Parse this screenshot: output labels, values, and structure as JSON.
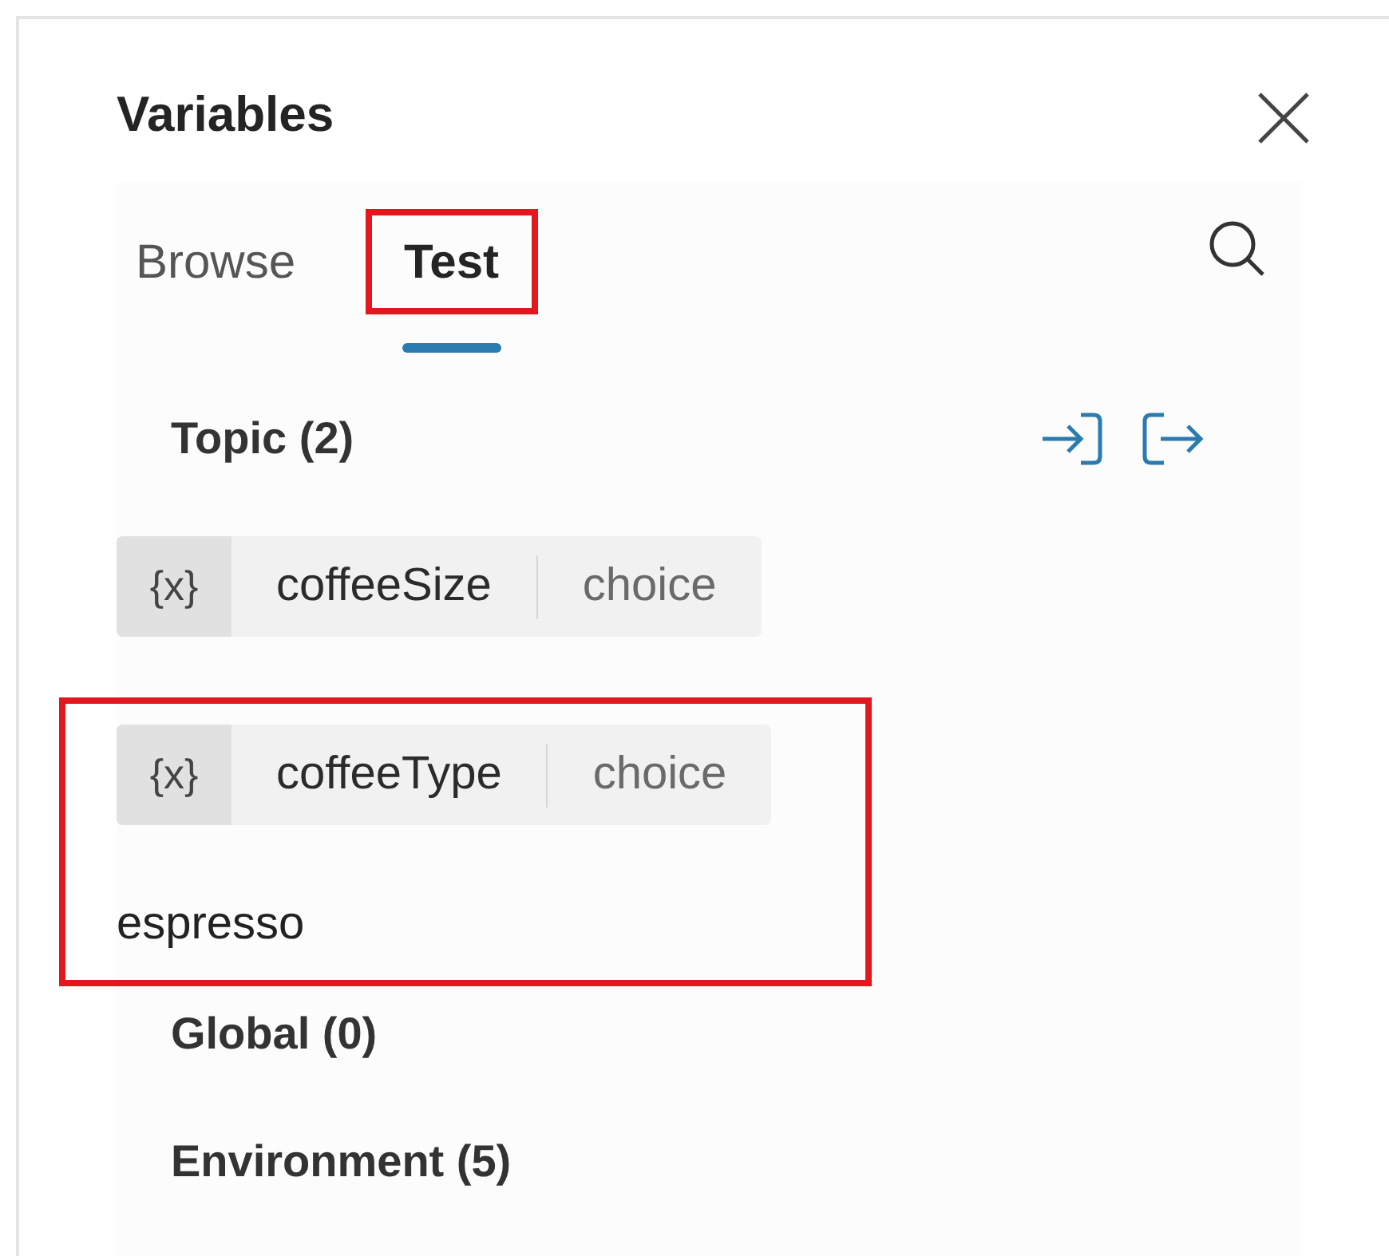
{
  "title": "Variables",
  "tabs": [
    {
      "label": "Browse",
      "selected": false,
      "highlighted": false
    },
    {
      "label": "Test",
      "selected": true,
      "highlighted": true
    }
  ],
  "sections": [
    {
      "label": "Topic (2)",
      "variables": [
        {
          "icon": "{x}",
          "name": "coffeeSize",
          "type": "choice",
          "highlighted": false
        },
        {
          "icon": "{x}",
          "name": "coffeeType",
          "type": "choice",
          "value": "espresso",
          "highlighted": true
        }
      ]
    },
    {
      "label": "Global (0)"
    },
    {
      "label": "Environment (5)"
    }
  ]
}
